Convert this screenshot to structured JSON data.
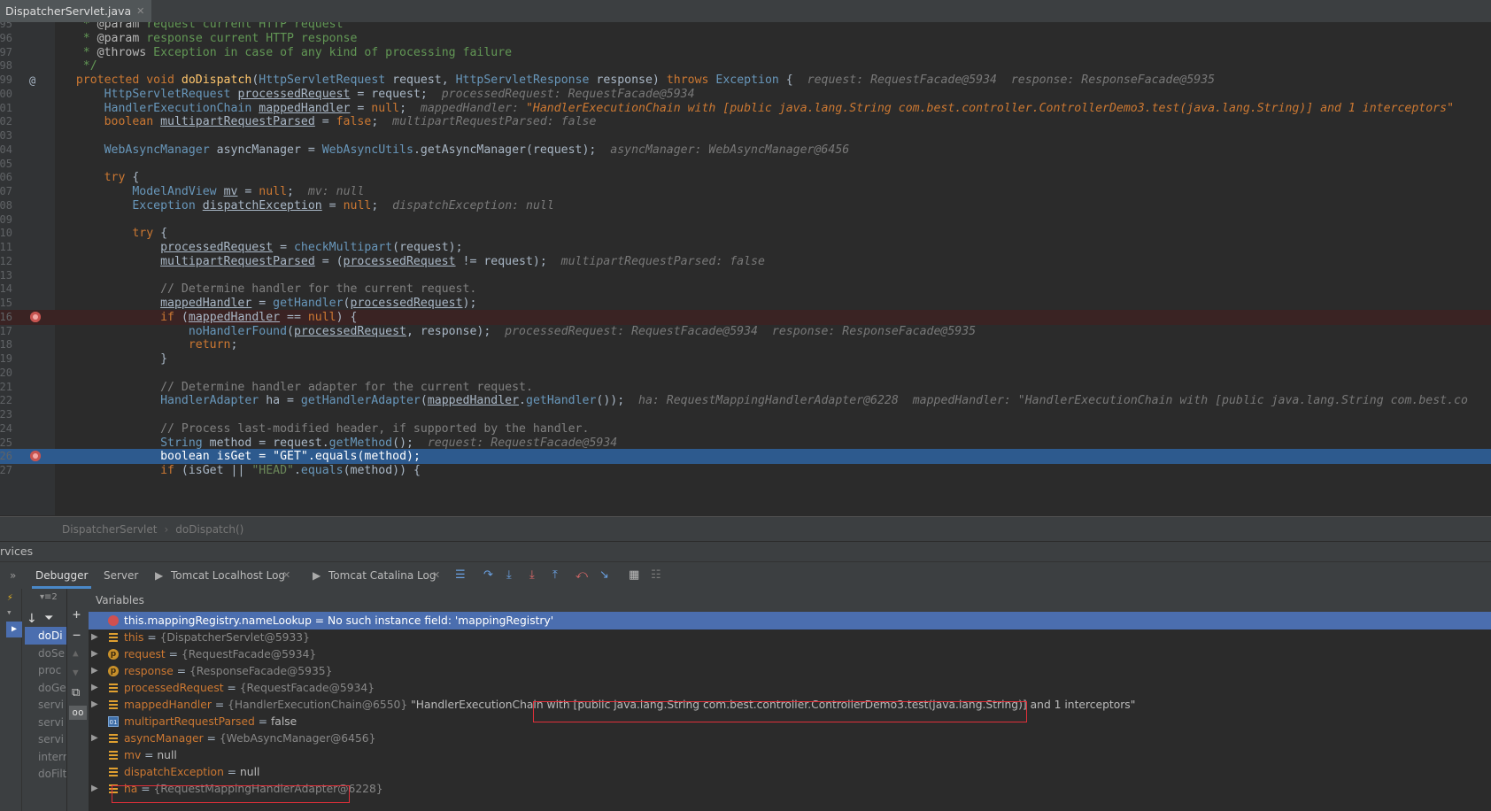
{
  "file_tab": {
    "name": "DispatcherServlet.java",
    "close": "✕"
  },
  "code_lines": [
    {
      "ln": "95",
      "marker": "",
      "cls": "",
      "parts": [
        [
          "    "
        ],
        [
          "* ",
          "jd"
        ],
        [
          "@param",
          "jdtag"
        ],
        [
          " request current HTTP request",
          "jd"
        ]
      ]
    },
    {
      "ln": "96",
      "marker": "",
      "cls": "",
      "parts": [
        [
          "    "
        ],
        [
          "* ",
          "jd"
        ],
        [
          "@param",
          "jdtag"
        ],
        [
          " response current HTTP response",
          "jd"
        ]
      ]
    },
    {
      "ln": "97",
      "marker": "",
      "cls": "",
      "parts": [
        [
          "    "
        ],
        [
          "* ",
          "jd"
        ],
        [
          "@throws",
          "jdtag"
        ],
        [
          " Exception in case of any kind of processing failure",
          "jd"
        ]
      ]
    },
    {
      "ln": "98",
      "marker": "",
      "cls": "",
      "parts": [
        [
          "    "
        ],
        [
          "*/",
          "jd"
        ]
      ]
    },
    {
      "ln": "99",
      "marker": "@",
      "cls": "",
      "parts": [
        [
          "   "
        ],
        [
          "protected void ",
          "kw"
        ],
        [
          "doDispatch",
          "fn"
        ],
        [
          "("
        ],
        [
          "HttpServletRequest ",
          "ty"
        ],
        [
          "request, "
        ],
        [
          "HttpServletResponse ",
          "ty"
        ],
        [
          "response) "
        ],
        [
          "throws ",
          "kw"
        ],
        [
          "Exception ",
          "ty"
        ],
        [
          "{  "
        ],
        [
          "request: RequestFacade@5934  response: ResponseFacade@5935",
          "hint"
        ]
      ]
    },
    {
      "ln": "00",
      "marker": "",
      "cls": "",
      "parts": [
        [
          "       "
        ],
        [
          "HttpServletRequest ",
          "ty"
        ],
        [
          "processedRequest",
          "ul"
        ],
        [
          " = request;  "
        ],
        [
          "processedRequest: RequestFacade@5934",
          "hint"
        ]
      ]
    },
    {
      "ln": "01",
      "marker": "",
      "cls": "",
      "parts": [
        [
          "       "
        ],
        [
          "HandlerExecutionChain ",
          "ty"
        ],
        [
          "mappedHandler",
          "ul"
        ],
        [
          " = "
        ],
        [
          "null",
          "kw"
        ],
        [
          ";  "
        ],
        [
          "mappedHandler: ",
          "hint"
        ],
        [
          "\"HandlerExecutionChain with [public java.lang.String com.best.controller.ControllerDemo3.test(java.lang.String)] and 1 interceptors\"",
          "hintstr"
        ]
      ]
    },
    {
      "ln": "02",
      "marker": "",
      "cls": "",
      "parts": [
        [
          "       "
        ],
        [
          "boolean ",
          "kw"
        ],
        [
          "multipartRequestParsed",
          "ul"
        ],
        [
          " = "
        ],
        [
          "false",
          "kw"
        ],
        [
          ";  "
        ],
        [
          "multipartRequestParsed: false",
          "hint"
        ]
      ]
    },
    {
      "ln": "03",
      "marker": "",
      "cls": "",
      "parts": [
        [
          ""
        ]
      ]
    },
    {
      "ln": "04",
      "marker": "",
      "cls": "",
      "parts": [
        [
          "       "
        ],
        [
          "WebAsyncManager ",
          "ty"
        ],
        [
          "asyncManager = "
        ],
        [
          "WebAsyncUtils",
          "ty"
        ],
        [
          ".getAsyncManager(request);  "
        ],
        [
          "asyncManager: WebAsyncManager@6456",
          "hint"
        ]
      ]
    },
    {
      "ln": "05",
      "marker": "",
      "cls": "",
      "parts": [
        [
          ""
        ]
      ]
    },
    {
      "ln": "06",
      "marker": "",
      "cls": "",
      "parts": [
        [
          "       "
        ],
        [
          "try ",
          "kw"
        ],
        [
          "{"
        ]
      ]
    },
    {
      "ln": "07",
      "marker": "",
      "cls": "",
      "parts": [
        [
          "           "
        ],
        [
          "ModelAndView ",
          "ty"
        ],
        [
          "mv",
          "ul"
        ],
        [
          " = "
        ],
        [
          "null",
          "kw"
        ],
        [
          ";  "
        ],
        [
          "mv: null",
          "hint"
        ]
      ]
    },
    {
      "ln": "08",
      "marker": "",
      "cls": "",
      "parts": [
        [
          "           "
        ],
        [
          "Exception ",
          "ty"
        ],
        [
          "dispatchException",
          "ul"
        ],
        [
          " = "
        ],
        [
          "null",
          "kw"
        ],
        [
          ";  "
        ],
        [
          "dispatchException: null",
          "hint"
        ]
      ]
    },
    {
      "ln": "09",
      "marker": "",
      "cls": "",
      "parts": [
        [
          ""
        ]
      ]
    },
    {
      "ln": "10",
      "marker": "",
      "cls": "",
      "parts": [
        [
          "           "
        ],
        [
          "try ",
          "kw"
        ],
        [
          "{"
        ]
      ]
    },
    {
      "ln": "11",
      "marker": "",
      "cls": "",
      "parts": [
        [
          "               "
        ],
        [
          "processedRequest",
          "ul"
        ],
        [
          " = "
        ],
        [
          "checkMultipart",
          "st"
        ],
        [
          "(request);"
        ]
      ]
    },
    {
      "ln": "12",
      "marker": "",
      "cls": "",
      "parts": [
        [
          "               "
        ],
        [
          "multipartRequestParsed",
          "ul"
        ],
        [
          " = ("
        ],
        [
          "processedRequest",
          "ul"
        ],
        [
          " != request);  "
        ],
        [
          "multipartRequestParsed: false",
          "hint"
        ]
      ]
    },
    {
      "ln": "13",
      "marker": "",
      "cls": "",
      "parts": [
        [
          ""
        ]
      ]
    },
    {
      "ln": "14",
      "marker": "",
      "cls": "",
      "parts": [
        [
          "               "
        ],
        [
          "// Determine handler for the current request.",
          "cmline"
        ]
      ]
    },
    {
      "ln": "15",
      "marker": "",
      "cls": "",
      "parts": [
        [
          "               "
        ],
        [
          "mappedHandler",
          "ul"
        ],
        [
          " = "
        ],
        [
          "getHandler",
          "st"
        ],
        [
          "("
        ],
        [
          "processedRequest",
          "ul"
        ],
        [
          ");"
        ]
      ]
    },
    {
      "ln": "16",
      "marker": "bp",
      "cls": "bp",
      "parts": [
        [
          "               "
        ],
        [
          "if ",
          "kw"
        ],
        [
          "("
        ],
        [
          "mappedHandler",
          "ul"
        ],
        [
          " == "
        ],
        [
          "null",
          "kw"
        ],
        [
          ") {"
        ]
      ]
    },
    {
      "ln": "17",
      "marker": "",
      "cls": "",
      "parts": [
        [
          "                   "
        ],
        [
          "noHandlerFound",
          "st"
        ],
        [
          "("
        ],
        [
          "processedRequest",
          "ul"
        ],
        [
          ", response);  "
        ],
        [
          "processedRequest: RequestFacade@5934  response: ResponseFacade@5935",
          "hint"
        ]
      ]
    },
    {
      "ln": "18",
      "marker": "",
      "cls": "",
      "parts": [
        [
          "                   "
        ],
        [
          "return",
          "kw"
        ],
        [
          ";"
        ]
      ]
    },
    {
      "ln": "19",
      "marker": "",
      "cls": "",
      "parts": [
        [
          "               "
        ],
        [
          "}"
        ]
      ]
    },
    {
      "ln": "20",
      "marker": "",
      "cls": "",
      "parts": [
        [
          ""
        ]
      ]
    },
    {
      "ln": "21",
      "marker": "",
      "cls": "",
      "parts": [
        [
          "               "
        ],
        [
          "// Determine handler adapter for the current request.",
          "cmline"
        ]
      ]
    },
    {
      "ln": "22",
      "marker": "",
      "cls": "",
      "parts": [
        [
          "               "
        ],
        [
          "HandlerAdapter ",
          "ty"
        ],
        [
          "ha = "
        ],
        [
          "getHandlerAdapter",
          "st"
        ],
        [
          "("
        ],
        [
          "mappedHandler",
          "ul"
        ],
        [
          "."
        ],
        [
          "getHandler",
          "st"
        ],
        [
          "());  "
        ],
        [
          "ha: RequestMappingHandlerAdapter@6228  mappedHandler: \"HandlerExecutionChain with [public java.lang.String com.best.co",
          "hint"
        ]
      ]
    },
    {
      "ln": "23",
      "marker": "",
      "cls": "",
      "parts": [
        [
          ""
        ]
      ]
    },
    {
      "ln": "24",
      "marker": "",
      "cls": "",
      "parts": [
        [
          "               "
        ],
        [
          "// Process last-modified header, if supported by the handler.",
          "cmline"
        ]
      ]
    },
    {
      "ln": "25",
      "marker": "",
      "cls": "",
      "parts": [
        [
          "               "
        ],
        [
          "String ",
          "ty"
        ],
        [
          "method = request."
        ],
        [
          "getMethod",
          "st"
        ],
        [
          "();  "
        ],
        [
          "request: RequestFacade@5934",
          "hint"
        ]
      ]
    },
    {
      "ln": "26",
      "marker": "bp",
      "cls": "cur",
      "parts": [
        [
          "               "
        ],
        [
          "boolean ",
          "kw"
        ],
        [
          "isGet = "
        ],
        [
          "\"GET\"",
          "str"
        ],
        [
          "."
        ],
        [
          "equals",
          "st"
        ],
        [
          "(method);"
        ]
      ]
    },
    {
      "ln": "27",
      "marker": "",
      "cls": "",
      "parts": [
        [
          "               "
        ],
        [
          "if ",
          "kw"
        ],
        [
          "(isGet || "
        ],
        [
          "\"HEAD\"",
          "str"
        ],
        [
          "."
        ],
        [
          "equals",
          "st"
        ],
        [
          "(method)) {"
        ]
      ]
    }
  ],
  "breadcrumb": [
    "DispatcherServlet",
    "doDispatch()"
  ],
  "services_label": "rvices",
  "debug_tabs": {
    "debugger": "Debugger",
    "server": "Server",
    "tomcat_localhost": "Tomcat Localhost Log",
    "tomcat_catalina": "Tomcat Catalina Log"
  },
  "variables_title": "Variables",
  "frames": [
    "doDi",
    "doSe",
    "proc",
    "doGe",
    "servi",
    "servi",
    "servi",
    "interr",
    "doFilt"
  ],
  "variables": [
    {
      "icon": "err",
      "expand": false,
      "sel": true,
      "name": "this.mappingRegistry.nameLookup",
      "eq": " = ",
      "val": "",
      "plain": "No such instance field: 'mappingRegistry'"
    },
    {
      "icon": "field",
      "expand": true,
      "name": "this",
      "eq": " = ",
      "val": "{DispatcherServlet@5933}",
      "plain": ""
    },
    {
      "icon": "p",
      "expand": true,
      "name": "request",
      "eq": " = ",
      "val": "{RequestFacade@5934}",
      "plain": ""
    },
    {
      "icon": "p",
      "expand": true,
      "name": "response",
      "eq": " = ",
      "val": "{ResponseFacade@5935}",
      "plain": ""
    },
    {
      "icon": "field",
      "expand": true,
      "name": "processedRequest",
      "eq": " = ",
      "val": "{RequestFacade@5934}",
      "plain": ""
    },
    {
      "icon": "field",
      "expand": true,
      "name": "mappedHandler",
      "eq": " = ",
      "val": "{HandlerExecutionChain@6550}",
      "plain": " \"HandlerExecutionChain with [public java.lang.String com.best.controller.ControllerDemo3.test(java.lang.String)] and 1 interceptors\""
    },
    {
      "icon": "bool",
      "expand": false,
      "name": "multipartRequestParsed",
      "eq": " = ",
      "val": "",
      "plain": "false"
    },
    {
      "icon": "field",
      "expand": true,
      "name": "asyncManager",
      "eq": " = ",
      "val": "{WebAsyncManager@6456}",
      "plain": ""
    },
    {
      "icon": "field",
      "expand": false,
      "name": "mv",
      "eq": " = ",
      "val": "",
      "plain": "null"
    },
    {
      "icon": "field",
      "expand": false,
      "name": "dispatchException",
      "eq": " = ",
      "val": "",
      "plain": "null"
    },
    {
      "icon": "field",
      "expand": true,
      "name": "ha",
      "eq": " = ",
      "val": "{RequestMappingHandlerAdapter@6228}",
      "plain": ""
    }
  ],
  "colors": {
    "accent": "#4b6eaf",
    "breakpoint": "#c75450",
    "highlight_box": "#e0303a"
  }
}
